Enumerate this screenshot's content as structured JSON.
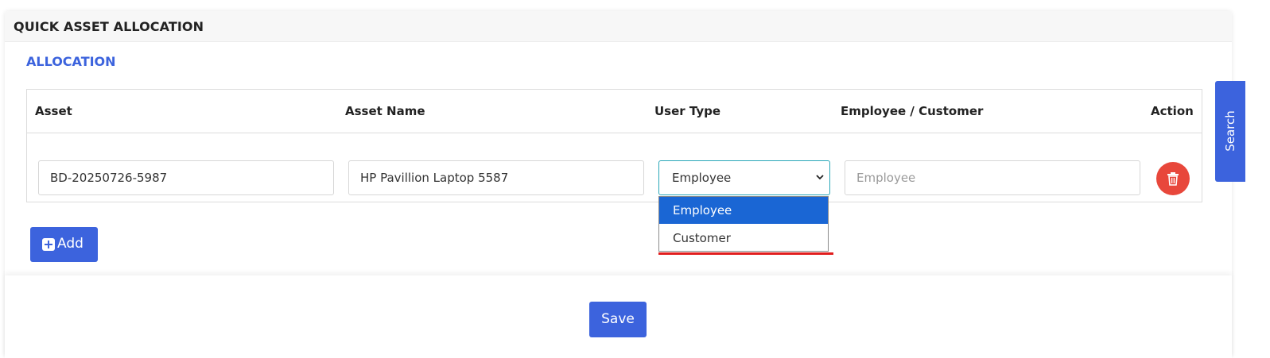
{
  "card": {
    "title": "QUICK ASSET ALLOCATION",
    "section_title": "ALLOCATION"
  },
  "table": {
    "headers": {
      "asset": "Asset",
      "asset_name": "Asset Name",
      "user_type": "User Type",
      "employee_customer": "Employee / Customer",
      "action": "Action"
    },
    "row": {
      "asset_value": "BD-20250726-5987",
      "asset_name_value": "HP Pavillion Laptop 5587",
      "user_type_selected": "Employee",
      "employee_placeholder": "Employee"
    }
  },
  "dropdown": {
    "options": [
      "Employee",
      "Customer"
    ],
    "highlighted": "Employee"
  },
  "buttons": {
    "add_label": "Add",
    "save_label": "Save",
    "search_tab_label": "Search"
  },
  "icons": {
    "add": "plus-square-icon",
    "delete": "trash-icon",
    "select": "chevron-down-icon"
  },
  "colors": {
    "primary": "#3c63dd",
    "danger": "#e8473b",
    "dropdown_highlight": "#1a66d4",
    "select_focus_border": "#2aa7b8",
    "annotation_red": "#e11d1d"
  }
}
